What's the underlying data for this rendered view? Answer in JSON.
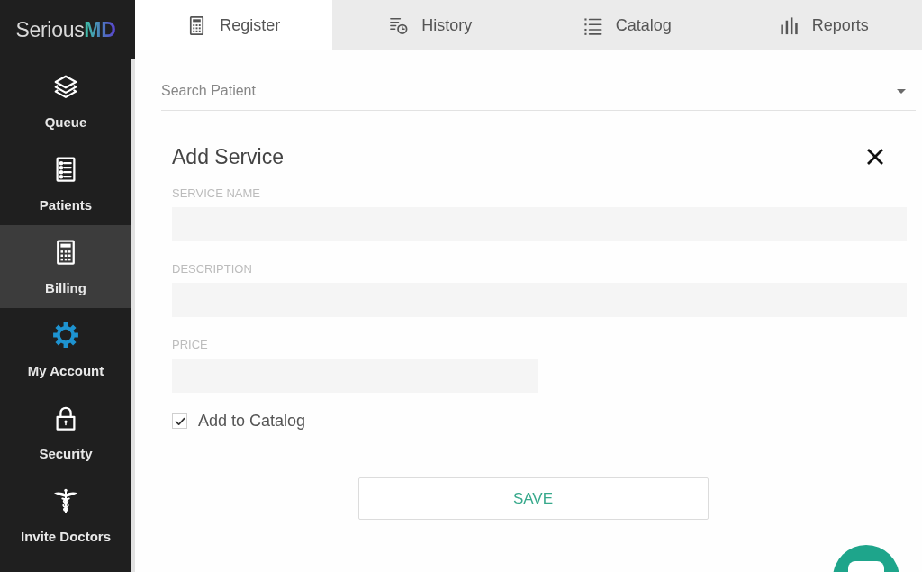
{
  "sidebar": {
    "logo": {
      "text": "Serious",
      "accent": "MD"
    },
    "items": [
      {
        "label": "Queue",
        "selected": false,
        "color": "#ffffff"
      },
      {
        "label": "Patients",
        "selected": false,
        "color": "#ffffff"
      },
      {
        "label": "Billing",
        "selected": true,
        "color": "#ffffff"
      },
      {
        "label": "My Account",
        "selected": false,
        "color": "#1e93d0"
      },
      {
        "label": "Security",
        "selected": false,
        "color": "#ffffff"
      },
      {
        "label": "Invite Doctors",
        "selected": false,
        "color": "#ffffff"
      }
    ]
  },
  "tabs": [
    {
      "label": "Register",
      "selected": true
    },
    {
      "label": "History",
      "selected": false
    },
    {
      "label": "Catalog",
      "selected": false
    },
    {
      "label": "Reports",
      "selected": false
    }
  ],
  "search": {
    "placeholder": "Search Patient"
  },
  "form": {
    "title": "Add Service",
    "fields": [
      {
        "label": "SERVICE NAME",
        "kind": "wide"
      },
      {
        "label": "DESCRIPTION",
        "kind": "wide"
      },
      {
        "label": "PRICE",
        "kind": "narrow"
      }
    ],
    "add_to_catalog": {
      "label": "Add to Catalog",
      "checked": true
    },
    "save_button": "SAVE"
  }
}
